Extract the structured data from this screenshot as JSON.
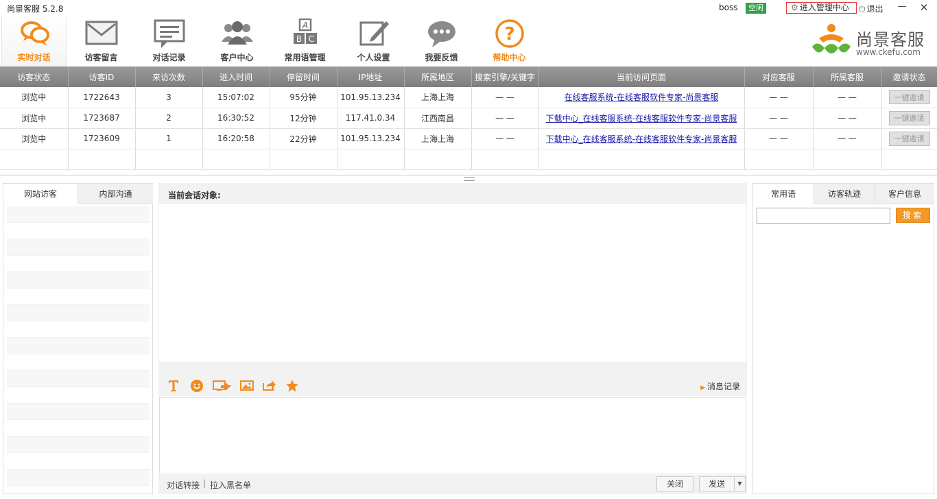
{
  "titlebar": {
    "app_title": "尚景客服 5.2.8",
    "user_name": "boss",
    "status": "空闲",
    "admin_link": "进入管理中心",
    "logout": "退出"
  },
  "toolbar": {
    "items": [
      {
        "label": "实时对话",
        "icon": "chat-bubbles-icon"
      },
      {
        "label": "访客留言",
        "icon": "envelope-icon"
      },
      {
        "label": "对话记录",
        "icon": "chat-record-icon"
      },
      {
        "label": "客户中心",
        "icon": "users-icon"
      },
      {
        "label": "常用语管理",
        "icon": "abc-blocks-icon"
      },
      {
        "label": "个人设置",
        "icon": "edit-icon"
      },
      {
        "label": "我要反馈",
        "icon": "speech-dots-icon"
      },
      {
        "label": "帮助中心",
        "icon": "help-icon"
      }
    ],
    "active_item": "实时对话"
  },
  "brand": {
    "name": "尚景客服",
    "url": "www.ckefu.com"
  },
  "visitor_table": {
    "headers": [
      "访客状态",
      "访客ID",
      "来访次数",
      "进入时间",
      "停留时间",
      "IP地址",
      "所属地区",
      "搜索引擎/关键字",
      "当前访问页面",
      "对应客服",
      "所属客服",
      "邀请状态"
    ],
    "rows": [
      {
        "status": "浏览中",
        "id": "1722643",
        "visits": "3",
        "enter_time": "15:07:02",
        "stay": "95分钟",
        "ip": "101.95.13.234",
        "region": "上海上海",
        "search": "— —",
        "page": "在线客服系统-在线客服软件专家-尚景客服",
        "agent": "— —",
        "owner": "— —",
        "invite": "一键邀请"
      },
      {
        "status": "浏览中",
        "id": "1723687",
        "visits": "2",
        "enter_time": "16:30:52",
        "stay": "12分钟",
        "ip": "117.41.0.34",
        "region": "江西南昌",
        "search": "— —",
        "page": "下载中心_在线客服系统-在线客服软件专家-尚景客服",
        "agent": "— —",
        "owner": "— —",
        "invite": "一键邀请"
      },
      {
        "status": "浏览中",
        "id": "1723609",
        "visits": "1",
        "enter_time": "16:20:58",
        "stay": "22分钟",
        "ip": "101.95.13.234",
        "region": "上海上海",
        "search": "— —",
        "page": "下载中心_在线客服系统-在线客服软件专家-尚景客服",
        "agent": "— —",
        "owner": "— —",
        "invite": "一键邀请"
      }
    ]
  },
  "left_panel": {
    "tabs": [
      "网站访客",
      "内部沟通"
    ]
  },
  "chat": {
    "header": "当前会话对象:",
    "history_link": "消息记录",
    "transfer": "对话转接",
    "separator": "|",
    "blacklist": "拉入黑名单",
    "close_btn": "关闭",
    "send_btn": "发送"
  },
  "right_panel": {
    "tabs": [
      "常用语",
      "访客轨迹",
      "客户信息"
    ],
    "search_value": "",
    "search_btn": "搜索"
  },
  "colors": {
    "accent_orange": "#f38a1b",
    "status_green": "#33a14a",
    "header_gray": "#8a8a8a",
    "link_blue": "#1a1aa8"
  }
}
